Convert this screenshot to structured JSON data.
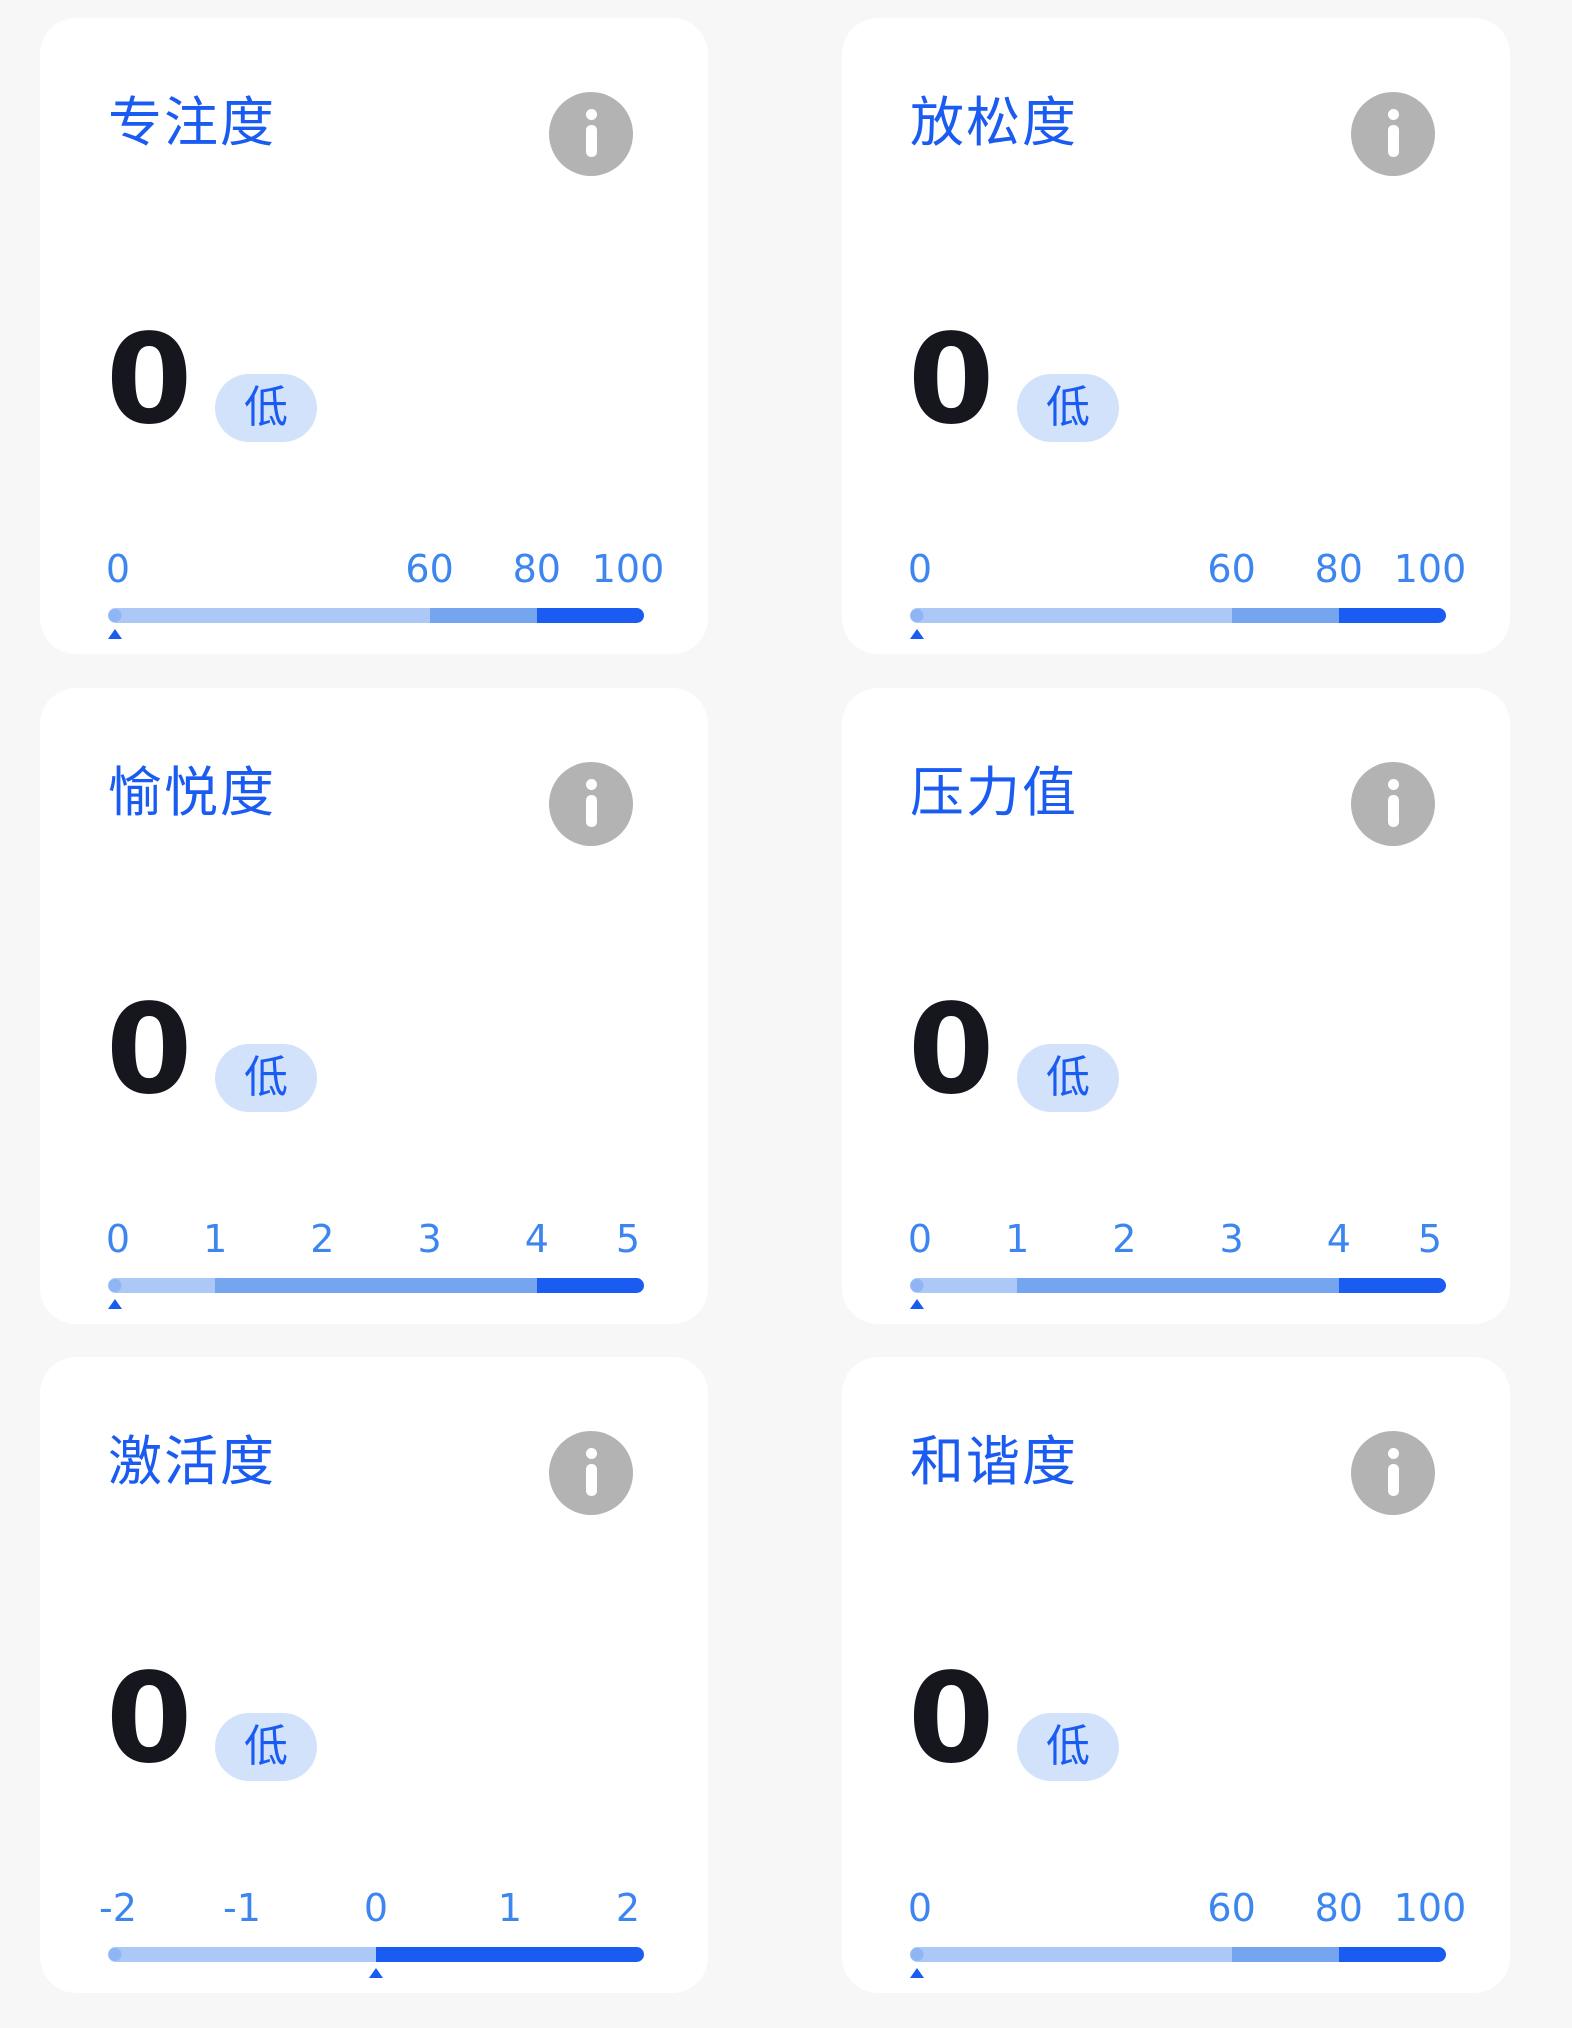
{
  "colors": {
    "accent": "#1a5bf2",
    "tick_text": "#3d86f0",
    "segment_low": "#abc8f6",
    "segment_mid": "#75a5ef",
    "segment_high": "#1a5bf2",
    "badge_bg": "#d2e2fb",
    "info_icon": "#b3b3b3",
    "value_text": "#16161e"
  },
  "cards": [
    {
      "title": "专注度",
      "value": "0",
      "level": "低",
      "icon": "info-icon",
      "scale": {
        "ticks": [
          "0",
          "60",
          "80",
          "100"
        ],
        "min": 0,
        "max": 100,
        "breaks": [
          60,
          80
        ],
        "current": 0
      }
    },
    {
      "title": "放松度",
      "value": "0",
      "level": "低",
      "icon": "info-icon",
      "scale": {
        "ticks": [
          "0",
          "60",
          "80",
          "100"
        ],
        "min": 0,
        "max": 100,
        "breaks": [
          60,
          80
        ],
        "current": 0
      }
    },
    {
      "title": "愉悦度",
      "value": "0",
      "level": "低",
      "icon": "info-icon",
      "scale": {
        "ticks": [
          "0",
          "1",
          "2",
          "3",
          "4",
          "5"
        ],
        "min": 0,
        "max": 5,
        "breaks": [
          1,
          4
        ],
        "current": 0
      }
    },
    {
      "title": "压力值",
      "value": "0",
      "level": "低",
      "icon": "info-icon",
      "scale": {
        "ticks": [
          "0",
          "1",
          "2",
          "3",
          "4",
          "5"
        ],
        "min": 0,
        "max": 5,
        "breaks": [
          1,
          4
        ],
        "current": 0
      }
    },
    {
      "title": "激活度",
      "value": "0",
      "level": "低",
      "icon": "info-icon",
      "scale": {
        "ticks": [
          "-2",
          "-1",
          "0",
          "1",
          "2"
        ],
        "min": -2,
        "max": 2,
        "breaks": [
          0,
          0
        ],
        "current": 0
      }
    },
    {
      "title": "和谐度",
      "value": "0",
      "level": "低",
      "icon": "info-icon",
      "scale": {
        "ticks": [
          "0",
          "60",
          "80",
          "100"
        ],
        "min": 0,
        "max": 100,
        "breaks": [
          60,
          80
        ],
        "current": 0
      }
    }
  ]
}
